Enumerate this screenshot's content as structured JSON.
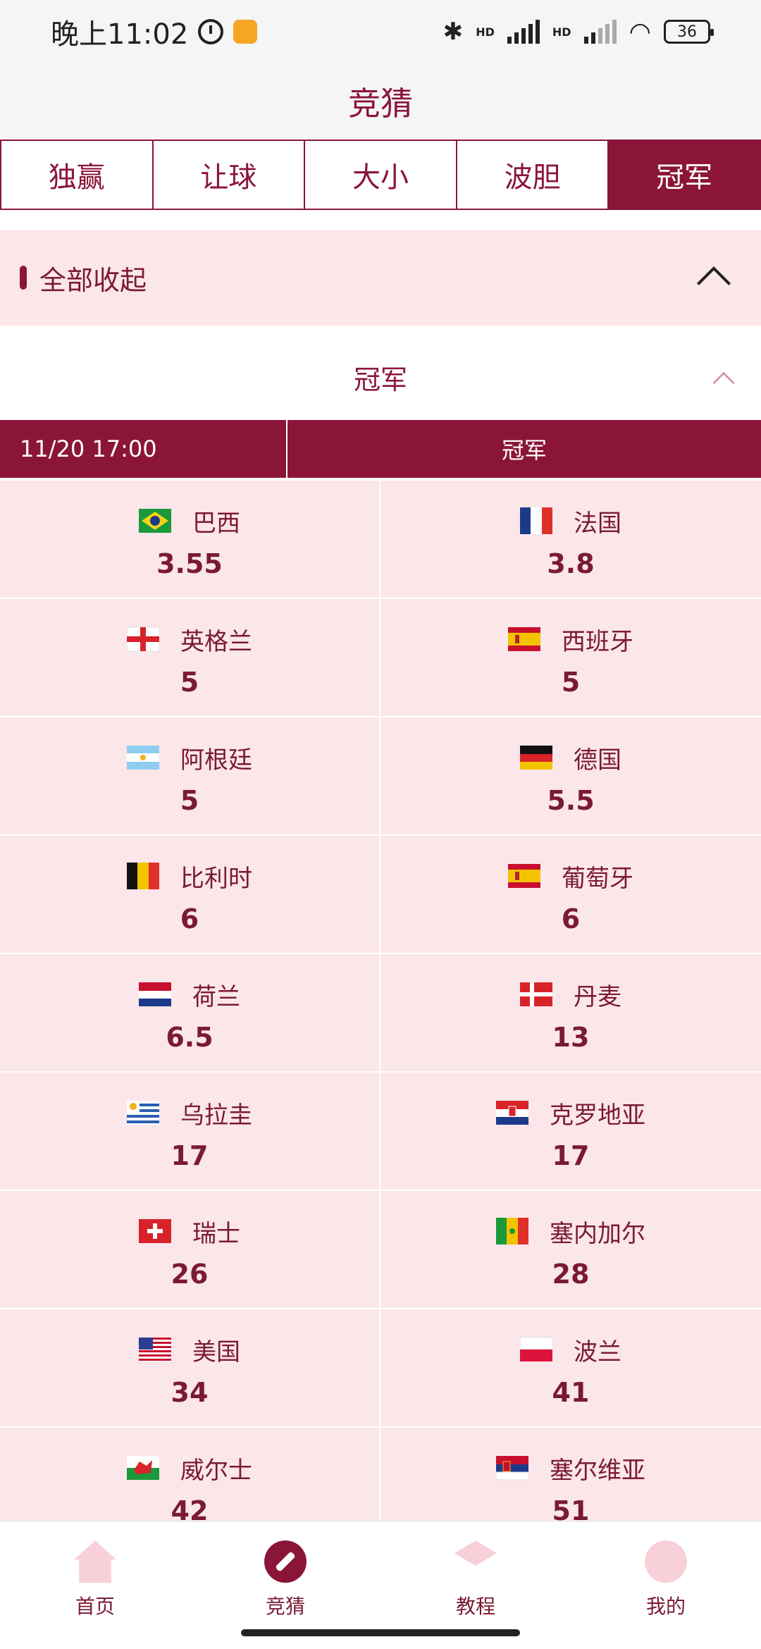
{
  "status_bar": {
    "time": "晚上11:02",
    "battery": "36",
    "hd1": "HD",
    "hd2": "HD"
  },
  "header": {
    "title": "竞猜"
  },
  "tabs": [
    {
      "label": "独赢",
      "active": false
    },
    {
      "label": "让球",
      "active": false
    },
    {
      "label": "大小",
      "active": false
    },
    {
      "label": "波胆",
      "active": false
    },
    {
      "label": "冠军",
      "active": true
    }
  ],
  "collapse_bar": {
    "label": "全部收起"
  },
  "section": {
    "title": "冠军"
  },
  "match": {
    "datetime": "11/20 17:00",
    "market": "冠军"
  },
  "teams": [
    {
      "name": "巴西",
      "odds": "3.55",
      "flag": "brazil"
    },
    {
      "name": "法国",
      "odds": "3.8",
      "flag": "france"
    },
    {
      "name": "英格兰",
      "odds": "5",
      "flag": "england"
    },
    {
      "name": "西班牙",
      "odds": "5",
      "flag": "spain"
    },
    {
      "name": "阿根廷",
      "odds": "5",
      "flag": "argentina"
    },
    {
      "name": "德国",
      "odds": "5.5",
      "flag": "germany"
    },
    {
      "name": "比利时",
      "odds": "6",
      "flag": "belgium"
    },
    {
      "name": "葡萄牙",
      "odds": "6",
      "flag": "portugal"
    },
    {
      "name": "荷兰",
      "odds": "6.5",
      "flag": "netherlands"
    },
    {
      "name": "丹麦",
      "odds": "13",
      "flag": "denmark"
    },
    {
      "name": "乌拉圭",
      "odds": "17",
      "flag": "uruguay"
    },
    {
      "name": "克罗地亚",
      "odds": "17",
      "flag": "croatia"
    },
    {
      "name": "瑞士",
      "odds": "26",
      "flag": "switzerland"
    },
    {
      "name": "塞内加尔",
      "odds": "28",
      "flag": "senegal"
    },
    {
      "name": "美国",
      "odds": "34",
      "flag": "usa"
    },
    {
      "name": "波兰",
      "odds": "41",
      "flag": "poland"
    },
    {
      "name": "威尔士",
      "odds": "42",
      "flag": "wales"
    },
    {
      "name": "塞尔维亚",
      "odds": "51",
      "flag": "serbia"
    }
  ],
  "bottom_nav": [
    {
      "label": "首页",
      "icon": "home-icon",
      "active": false
    },
    {
      "label": "竞猜",
      "icon": "compass-icon",
      "active": true
    },
    {
      "label": "教程",
      "icon": "layers-icon",
      "active": false
    },
    {
      "label": "我的",
      "icon": "profile-icon",
      "active": false
    }
  ],
  "colors": {
    "brand": "#8b1538",
    "cell_bg": "#fbe6ea",
    "header_bg": "#f5f5f5"
  }
}
